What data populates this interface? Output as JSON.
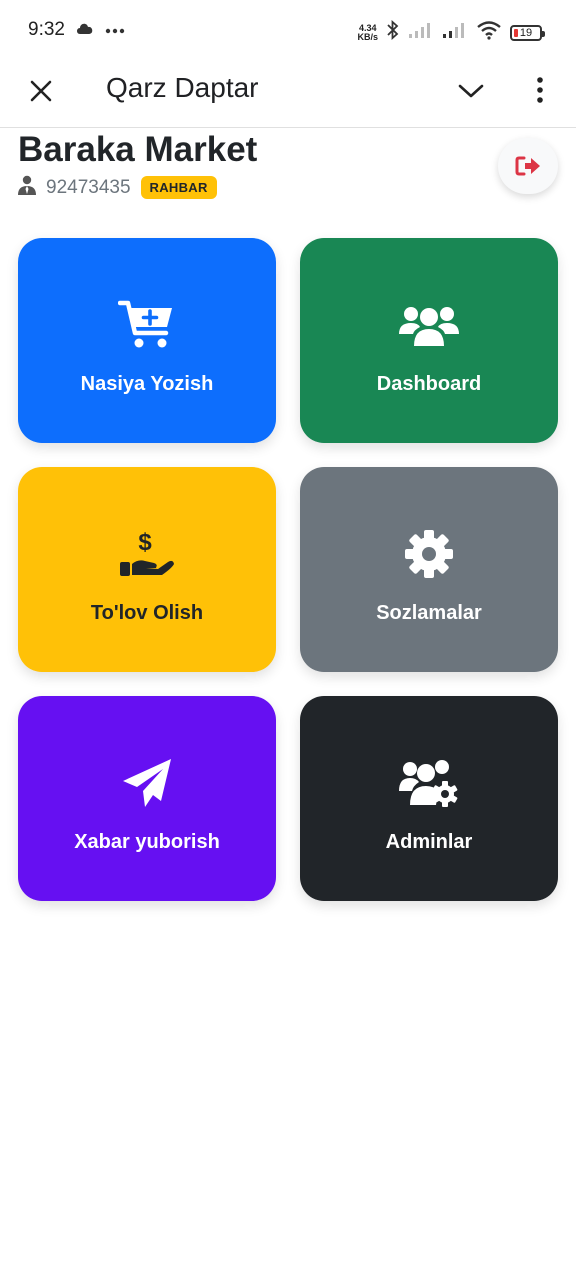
{
  "status_bar": {
    "time": "9:32",
    "speed_value": "4.34",
    "speed_unit": "KB/s",
    "battery": "19"
  },
  "app_bar": {
    "title": "Qarz Daptar"
  },
  "header": {
    "store_name": "Baraka Market",
    "phone": "92473435",
    "role": "RAHBAR"
  },
  "tiles": [
    {
      "label": "Nasiya Yozish",
      "icon": "cart-plus-icon",
      "color": "#0d6efd"
    },
    {
      "label": "Dashboard",
      "icon": "users-icon",
      "color": "#198754"
    },
    {
      "label": "To'lov Olish",
      "icon": "hand-dollar-icon",
      "color": "#ffc107"
    },
    {
      "label": "Sozlamalar",
      "icon": "gear-icon",
      "color": "#6c757d"
    },
    {
      "label": "Xabar yuborish",
      "icon": "paper-plane-icon",
      "color": "#6610f2"
    },
    {
      "label": "Adminlar",
      "icon": "users-gear-icon",
      "color": "#212529"
    }
  ],
  "colors": {
    "logout_icon": "#dc3545",
    "badge": "#ffc107"
  }
}
